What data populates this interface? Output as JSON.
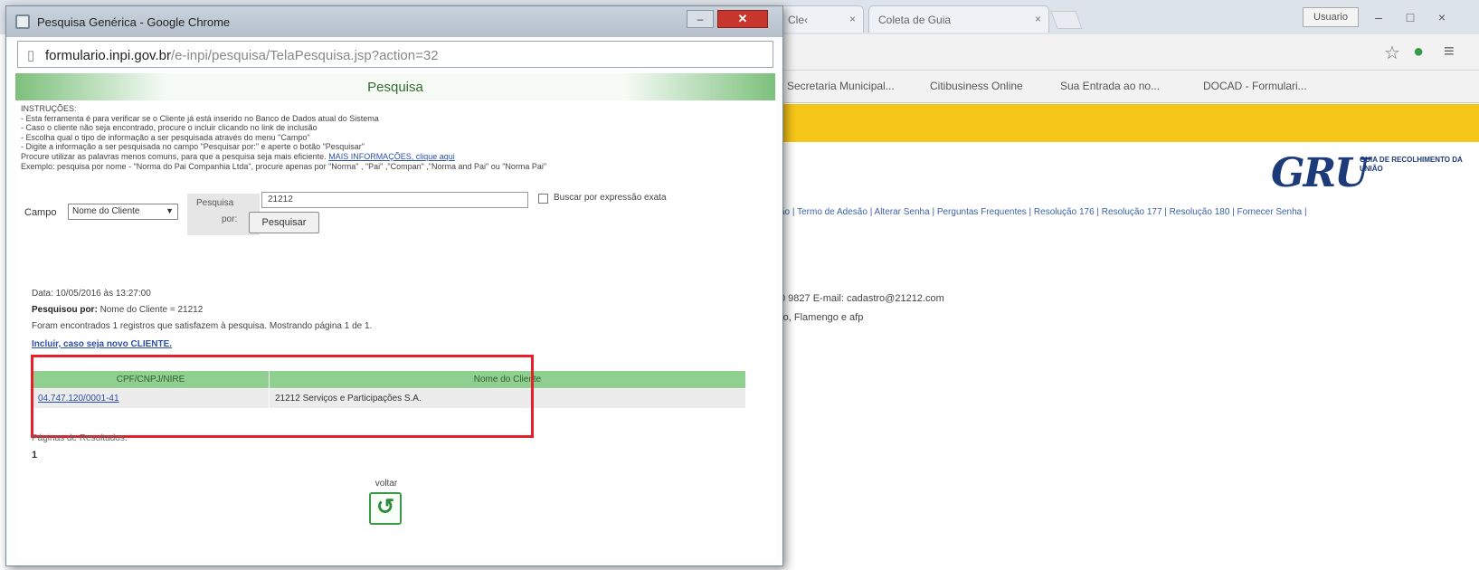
{
  "background_browser": {
    "tabs": [
      {
        "label": "Cle‹",
        "close": "×"
      },
      {
        "label": "Coleta de Guia",
        "close": "×"
      }
    ],
    "user_button": "Usuario",
    "window_controls": [
      "–",
      "□",
      "×"
    ],
    "bookmarks": [
      "Secretaria Municipal...",
      "Citibusiness Online",
      "Sua Entrada ao no...",
      "DOCAD - Formulari..."
    ],
    "gru_logo": {
      "mark": "GRU",
      "caption": "Guia de Recolhimento da União"
    },
    "nav_links": "ão | Termo de Adesão | Alterar Senha | Perguntas Frequentes | Resolução 176 | Resolução 177 | Resolução 180 | Fornecer Senha |",
    "contact_line": "0 9827  E-mail: cadastro@21212.com",
    "address_line": "ro, Flamengo e afp"
  },
  "popup": {
    "title": "Pesquisa Genérica - Google Chrome",
    "minimize": "–",
    "close": "✕",
    "url_host": "formulario.inpi.gov.br",
    "url_path": "/e-inpi/pesquisa/TelaPesquisa.jsp?action=32",
    "header_title": "Pesquisa",
    "instructions": [
      "INSTRUÇÕES:",
      "- Esta ferramenta é para verificar se o Cliente já está inserido no Banco de Dados atual do Sistema",
      "- Caso o cliente não seja encontrado, procure o incluir clicando no link de inclusão",
      "- Escolha qual o tipo de informação a ser pesquisada através do menu \"Campo\"",
      "- Digite a informação a ser pesquisada no campo \"Pesquisar por:\" e aperte o botão \"Pesquisar\""
    ],
    "instructions_tip": "Procure utilizar as palavras menos comuns, para que a pesquisa seja mais eficiente.",
    "instructions_link": "MAIS INFORMAÇÕES, clique aqui",
    "instructions_example": "Exemplo: pesquisa por nome - \"Norma do Pai Companhia Ltda\", procure apenas por \"Norma\" , \"Pai\" ,\"Compan\" ,\"Norma and Pai\" ou \"Norma Pai\"",
    "campo_label": "Campo",
    "campo_value": "Nome do Cliente",
    "pesquisa_label": "Pesquisa",
    "por_label": "por:",
    "search_value": "21212",
    "search_button": "Pesquisar",
    "exact_label": "Buscar por expressão exata",
    "result_date": "Data: 10/05/2016 às 13:27:00",
    "result_query_label": "Pesquisou por:",
    "result_query_value": " Nome do Cliente = 21212",
    "result_count": "Foram encontrados 1 registros que satisfazem à pesquisa. Mostrando página 1 de 1.",
    "include_link": "Incluir, caso seja novo CLIENTE.",
    "table": {
      "headers": [
        "CPF/CNPJ/NIRE",
        "Nome do Cliente"
      ],
      "rows": [
        [
          "04.747.120/0001-41",
          "21212 Serviços e Participações S.A."
        ]
      ]
    },
    "pages_label": "Páginas de Resultados:",
    "pages_value": "1",
    "voltar_label": "voltar",
    "voltar_icon": "↺"
  },
  "colors": {
    "highlight": "#e4202a",
    "header_green": "#8fcf8f",
    "gru_blue": "#1d3b7a",
    "banner_yellow": "#f5c518"
  }
}
